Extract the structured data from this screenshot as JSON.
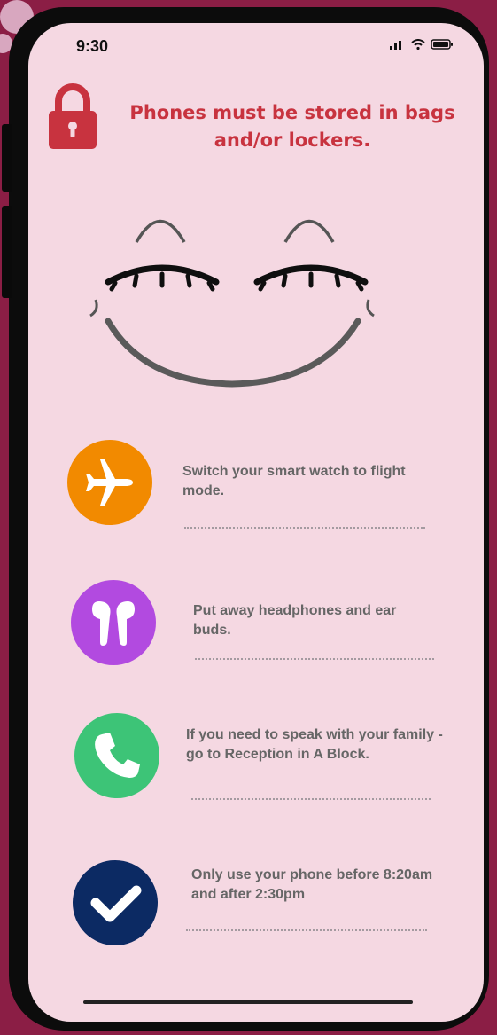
{
  "status_bar": {
    "time": "9:30"
  },
  "header": {
    "headline": "Phones must be stored in bags and/or lockers."
  },
  "items": [
    {
      "text": "Switch your smart watch to flight mode.",
      "icon": "airplane-icon",
      "color": "#f28a00"
    },
    {
      "text": "Put away headphones and ear buds.",
      "icon": "earbuds-icon",
      "color": "#b24ae0"
    },
    {
      "text": "If you need to speak with your family - go to Reception in A Block.",
      "icon": "phone-icon",
      "color": "#3dc477"
    },
    {
      "text": "Only use your phone before 8:20am and after 2:30pm",
      "icon": "checkmark-icon",
      "color": "#0c2a63"
    }
  ],
  "colors": {
    "background": "#8b1e45",
    "screen": "#f5d8e2",
    "accent": "#c8333f",
    "text": "#666666"
  }
}
